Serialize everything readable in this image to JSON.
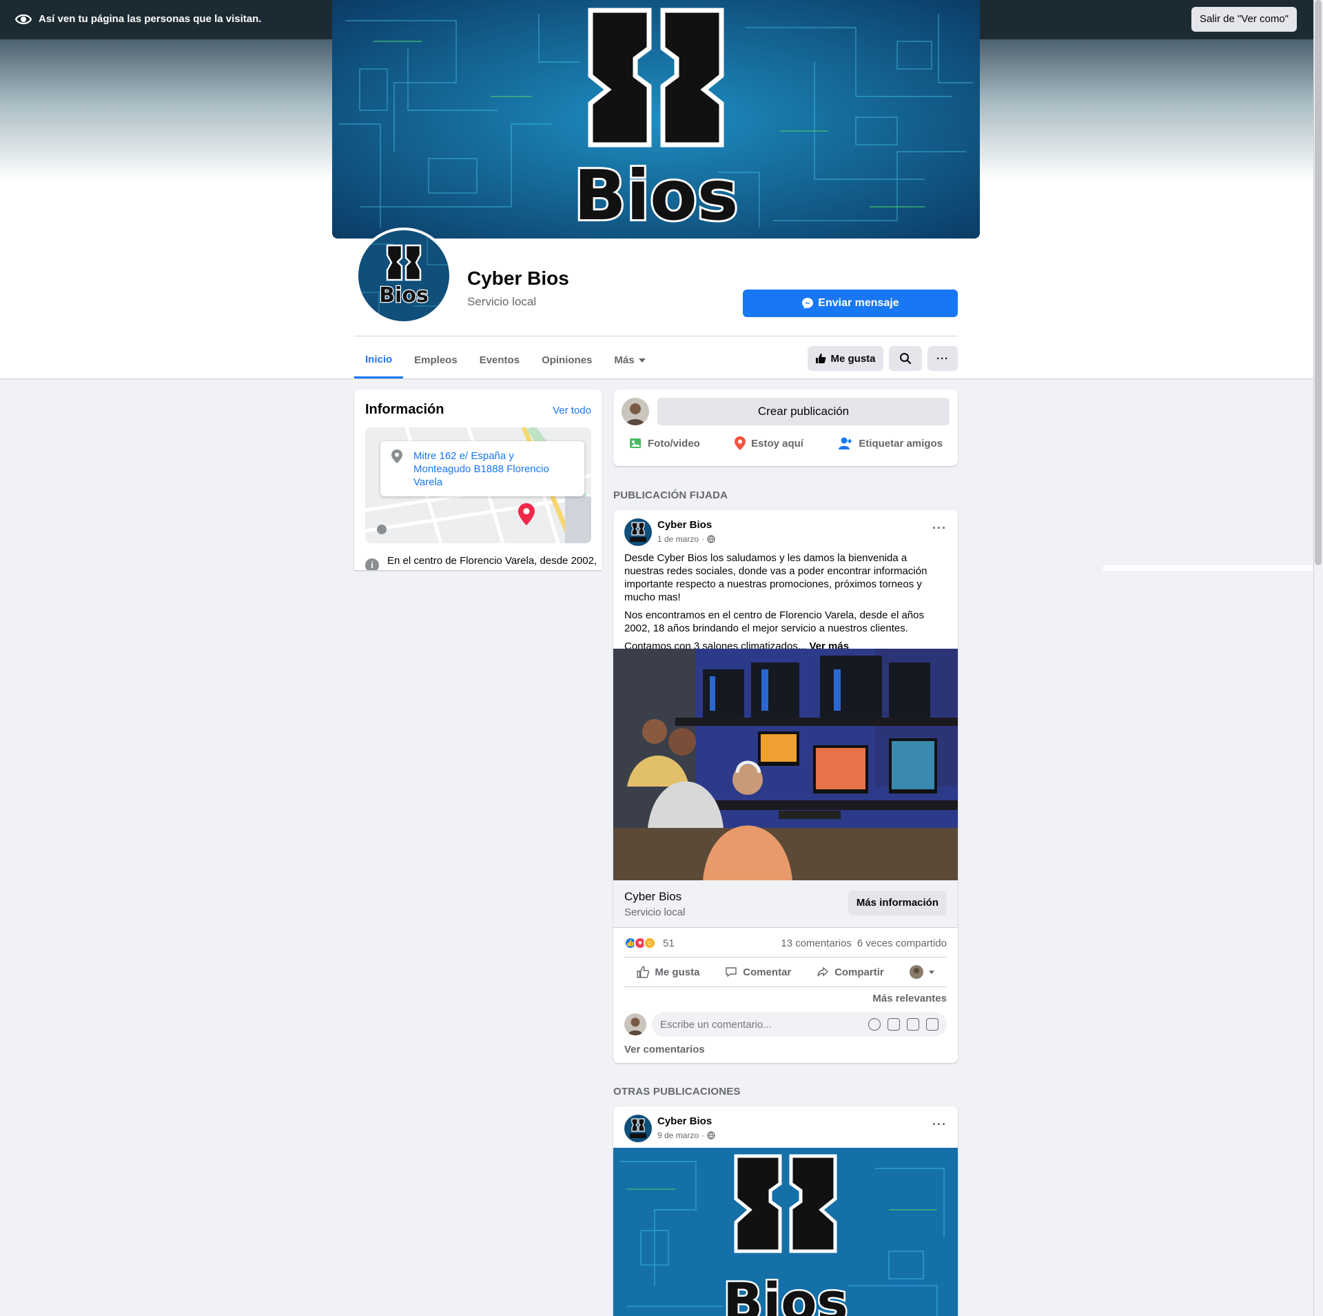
{
  "view_as": {
    "message": "Así ven tu página las personas que la visitan.",
    "exit_label": "Salir de \"Ver como\""
  },
  "page": {
    "name": "Cyber Bios",
    "category": "Servicio local",
    "logo_text": "Bios",
    "send_message_label": "Enviar mensaje"
  },
  "tabs": [
    {
      "label": "Inicio",
      "active": true
    },
    {
      "label": "Empleos"
    },
    {
      "label": "Eventos"
    },
    {
      "label": "Opiniones"
    },
    {
      "label": "Más"
    }
  ],
  "tab_actions": {
    "like_label": "Me gusta"
  },
  "info": {
    "title": "Información",
    "see_all": "Ver todo",
    "address": "Mitre 162 e/ España y Monteagudo B1888 Florencio Varela",
    "description": "En el centro de Florencio Varela, desde 2002,"
  },
  "create_post": {
    "button": "Crear publicación",
    "actions": [
      "Foto/video",
      "Estoy aquí",
      "Etiquetar amigos"
    ]
  },
  "sections": {
    "pinned": "PUBLICACIÓN FIJADA",
    "other": "OTRAS PUBLICACIONES"
  },
  "pinned_post": {
    "author": "Cyber Bios",
    "date": "1 de marzo",
    "paragraphs": [
      "Desde Cyber Bios los saludamos y les damos la bienvenida a nuestras redes sociales, donde vas a poder encontrar información importante respecto a nuestras promociones, próximos torneos y mucho mas!",
      "Nos encontramos en el centro de Florencio Varela, desde el años 2002, 18 años brindando el mejor servicio a nuestros clientes.",
      "Contamos con 3 salones climatizados..."
    ],
    "see_more": "Ver más",
    "link_title": "Cyber Bios",
    "link_subtitle": "Servicio local",
    "link_button": "Más información",
    "reaction_count": "51",
    "comments": "13 comentarios",
    "shares": "6 veces compartido",
    "actions": [
      "Me gusta",
      "Comentar",
      "Compartir"
    ],
    "sort": "Más relevantes",
    "comment_placeholder": "Escribe un comentario...",
    "see_comments": "Ver comentarios"
  },
  "second_post": {
    "author": "Cyber Bios",
    "date": "9 de marzo"
  },
  "colors": {
    "brand": "#1877f2",
    "background": "#f0f2f5",
    "muted": "#65676b"
  }
}
